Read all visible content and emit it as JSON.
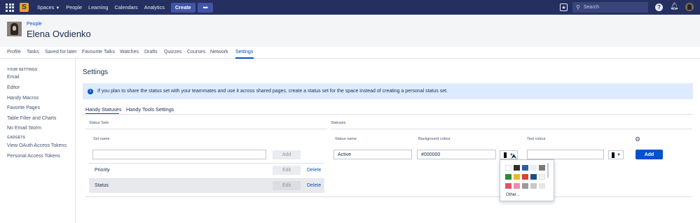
{
  "topnav": {
    "logo_letter": "S",
    "spaces": "Spaces",
    "people": "People",
    "learning": "Learning",
    "calendars": "Calendars",
    "analytics": "Analytics",
    "create": "Create",
    "more": "•••",
    "search_placeholder": "Search",
    "background": "#253061"
  },
  "profile": {
    "breadcrumb": "People",
    "name": "Elena Ovdienko"
  },
  "profile_tabs": [
    "Profile",
    "Tasks",
    "Saved for later",
    "Favourite Talks",
    "Watches",
    "Drafts",
    "Quizzes",
    "Courses",
    "Network",
    "Settings"
  ],
  "active_tab": "Settings",
  "sidebar": {
    "heading_1": "YOUR SETTINGS",
    "items_1": [
      "Email",
      "Editor",
      "Handy Macros",
      "Favorite Pages",
      "Table Filter and Charts",
      "No Email Storm"
    ],
    "heading_2": "GADGETS",
    "items_2": [
      "View OAuth Access Tokens",
      "Personal Access Tokens"
    ]
  },
  "main": {
    "title": "Settings",
    "info_text": "If you plan to share the status set with your teammates and use it across shared pages, create a status set for the space instead of creating a personal status set.",
    "sub_tabs": [
      "Handy Statuses",
      "Handy Tools Settings"
    ],
    "status_sets": {
      "label": "Status Sets",
      "set_name_label": "Set name",
      "set_name_value": "",
      "add_label": "Add",
      "rows": [
        {
          "name": "Priority",
          "edit": "Edit",
          "delete": "Delete"
        },
        {
          "name": "Status",
          "edit": "Edit",
          "delete": "Delete"
        }
      ]
    },
    "statuses": {
      "label": "Statuses",
      "status_name_label": "Status name",
      "background_label": "Background colour",
      "text_colour_label": "Text colour",
      "status_name_value": "Active",
      "background_value": "#000000",
      "text_colour_value": "",
      "add_label": "Add"
    },
    "palette": {
      "colors": [
        "#ffffff",
        "#2e2e2e",
        "#2f5f9e",
        "#e6eef8",
        "#7a7a7a",
        "#2f8a36",
        "#e9b92b",
        "#d8442f",
        "#1f4e86",
        "#f2f2f2",
        "#e3506d",
        "#ee8cab",
        "#9b9b9b",
        "#c8c8c8",
        "#e6e6e6"
      ],
      "other_label": "Other..."
    }
  }
}
